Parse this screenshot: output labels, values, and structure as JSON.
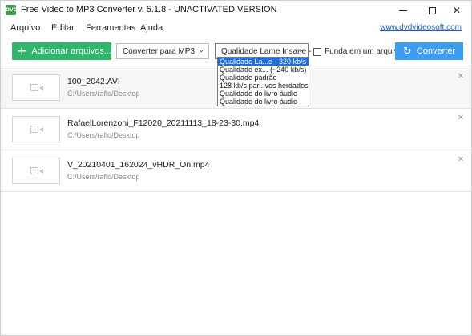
{
  "window": {
    "icon_text": "DVD",
    "title": "Free Video to MP3 Converter v. 5.1.8 - UNACTIVATED VERSION",
    "minimize_glyph": "",
    "close_glyph": "✕"
  },
  "menu": {
    "items": [
      "Arquivo",
      "Editar",
      "Ferramentas",
      "Ajuda"
    ],
    "site_link": "www.dvdvideosoft.com"
  },
  "toolbar": {
    "add_button_icon": "+",
    "add_button_label": "Adicionar arquivos...",
    "format_select_value": "Converter para MP3",
    "quality_select_value": "Qualidade Lame Insane -",
    "chevron": "⌄",
    "merge_checkbox_label": "Funda em um arquivo",
    "merge_checked": false,
    "convert_icon": "↻",
    "convert_button_label": "Converter"
  },
  "quality_dropdown": {
    "options": [
      "Qualidade La...e - 320 kb/s",
      "Qualidade ex... (~240 kb/s)",
      "Qualidade padrão",
      "128 kb/s par...vos herdados",
      "Qualidade do livro áudio",
      "Qualidade do livro áudio"
    ],
    "selected_index": 0
  },
  "files": [
    {
      "name": "100_2042.AVI",
      "path": "C:/Users/raflo/Desktop"
    },
    {
      "name": "RafaelLorenzoni_F12020_20211113_18-23-30.mp4",
      "path": "C:/Users/raflo/Desktop"
    },
    {
      "name": "V_20210401_162024_vHDR_On.mp4",
      "path": "C:/Users/raflo/Desktop"
    }
  ],
  "remove_glyph": "✕",
  "colors": {
    "add_button": "#2fb66c",
    "convert_button": "#3b9cf0",
    "link": "#1a5fd1",
    "dropdown_selected": "#1e6fd9"
  }
}
